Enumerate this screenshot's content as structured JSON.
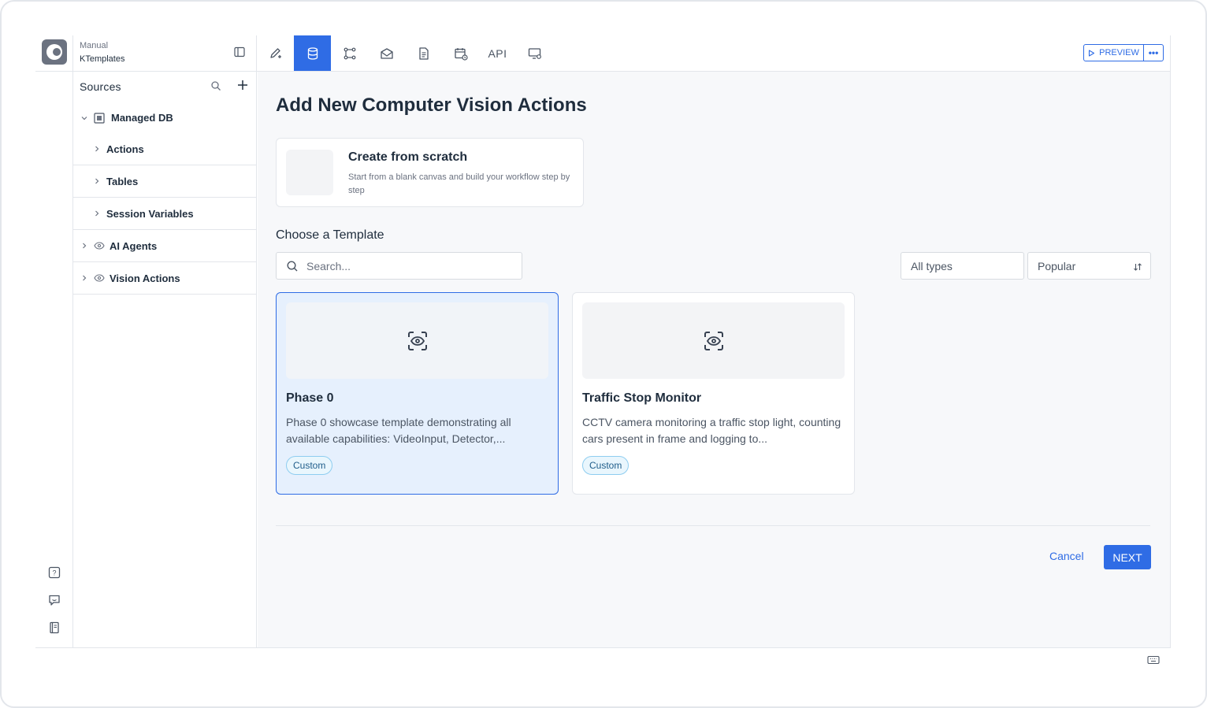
{
  "project": {
    "type": "Manual",
    "name": "KTemplates"
  },
  "sidebar": {
    "heading": "Sources",
    "tree": [
      {
        "label": "Managed DB",
        "level": 0,
        "icon": "database-icon",
        "expanded": true
      },
      {
        "label": "Actions",
        "level": 1
      },
      {
        "label": "Tables",
        "level": 1
      },
      {
        "label": "Session Variables",
        "level": 1
      },
      {
        "label": "AI Agents",
        "level": 0,
        "icon": "eye-icon"
      },
      {
        "label": "Vision Actions",
        "level": 0,
        "icon": "eye-icon"
      }
    ]
  },
  "toolbar": {
    "tools": [
      "edit-icon",
      "database-icon",
      "workflow-icon",
      "mail-icon",
      "document-icon",
      "calendar-icon",
      "api",
      "monitor-settings-icon"
    ],
    "api_label": "API",
    "active_tool": "database-icon",
    "preview_label": "PREVIEW",
    "more_label": "•••"
  },
  "main": {
    "title": "Add New Computer Vision Actions",
    "scratch": {
      "title": "Create from scratch",
      "description": "Start from a blank canvas and build your workflow step by step"
    },
    "choose_title": "Choose a Template",
    "search_placeholder": "Search...",
    "type_filter": "All types",
    "sort": "Popular",
    "templates": [
      {
        "name": "Phase 0",
        "description": "Phase 0 showcase template demonstrating all available capabilities: VideoInput, Detector,...",
        "badge": "Custom",
        "selected": true
      },
      {
        "name": "Traffic Stop Monitor",
        "description": "CCTV camera monitoring a traffic stop light, counting cars present in frame and logging to...",
        "badge": "Custom",
        "selected": false
      }
    ],
    "cancel_label": "Cancel",
    "next_label": "NEXT"
  },
  "colors": {
    "accent": "#2f6ce5",
    "selected_bg": "#e6f0fd",
    "badge_border": "#8ecdf0"
  }
}
